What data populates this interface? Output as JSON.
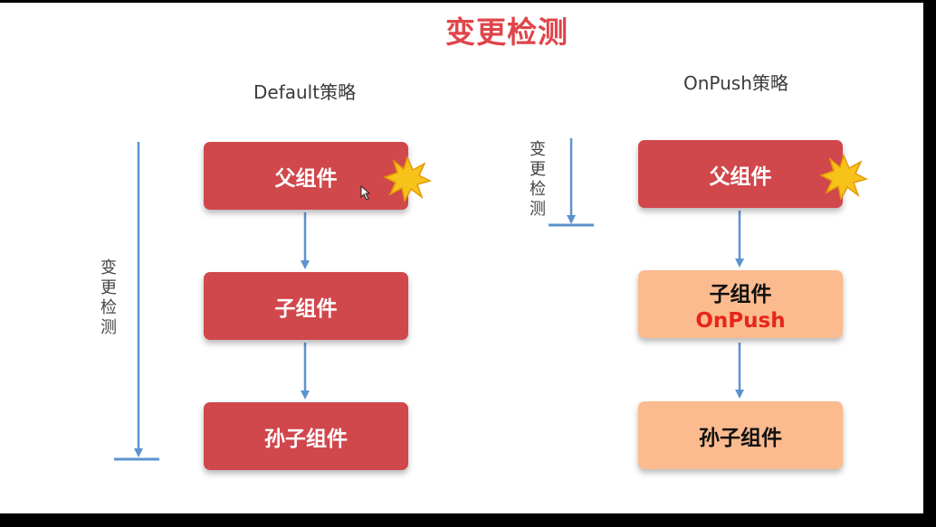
{
  "title": "变更检测",
  "default": {
    "heading": "Default策略",
    "side_label": "变更检测",
    "parent": "父组件",
    "child": "子组件",
    "grandchild": "孙子组件"
  },
  "onpush": {
    "heading": "OnPush策略",
    "side_label": "变更检测",
    "parent": "父组件",
    "child": "子组件",
    "child_tag": "OnPush",
    "grandchild": "孙子组件"
  },
  "colors": {
    "title": "#e0454a",
    "red_box": "#d0474c",
    "peach_box": "#fbbb8e",
    "arrow": "#5b93cf",
    "burst": "#f7c21a",
    "onpush_text": "#e8251d"
  }
}
